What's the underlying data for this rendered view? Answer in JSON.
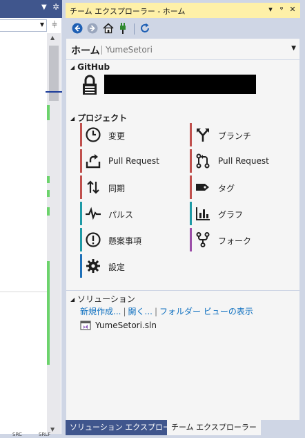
{
  "left_pane": {
    "status_left": "SRC",
    "status_right": "SRLF"
  },
  "window": {
    "title": "チーム エクスプローラー - ホーム",
    "dropdown_glyph": "▾",
    "pin_glyph": "📌",
    "close_glyph": "✕"
  },
  "toolbar": {
    "icons": [
      "back-icon",
      "forward-icon",
      "home-icon",
      "connect-icon",
      "refresh-icon"
    ]
  },
  "header": {
    "title": "ホーム",
    "repository": "YumeSetori"
  },
  "github": {
    "heading": "GitHub"
  },
  "project": {
    "heading": "プロジェクト",
    "tiles_left": [
      {
        "label": "変更",
        "icon": "clock-icon",
        "color": "#c0504d"
      },
      {
        "label": "Pull Request",
        "icon": "upload-icon",
        "color": "#c0504d"
      },
      {
        "label": "同期",
        "icon": "sync-icon",
        "color": "#c0504d"
      },
      {
        "label": "パルス",
        "icon": "pulse-icon",
        "color": "#1e9aa6"
      },
      {
        "label": "懸案事項",
        "icon": "issue-icon",
        "color": "#1e9aa6"
      },
      {
        "label": "設定",
        "icon": "gear-icon",
        "color": "#1e70b8"
      }
    ],
    "tiles_right": [
      {
        "label": "ブランチ",
        "icon": "branch-icon",
        "color": "#c0504d"
      },
      {
        "label": "Pull Request",
        "icon": "pull-request-icon",
        "color": "#c0504d"
      },
      {
        "label": "タグ",
        "icon": "tag-icon",
        "color": "#c0504d"
      },
      {
        "label": "グラフ",
        "icon": "graph-icon",
        "color": "#1e9aa6"
      },
      {
        "label": "フォーク",
        "icon": "fork-icon",
        "color": "#9b4ea8"
      }
    ]
  },
  "solutions": {
    "heading": "ソリューション",
    "new": "新規作成...",
    "open": "開く...",
    "folder_view": "フォルダー ビューの表示",
    "solution_file": "YumeSetori.sln"
  },
  "tabs": [
    {
      "label": "ソリューション エクスプローラー",
      "active": false
    },
    {
      "label": "チーム エクスプローラー",
      "active": true
    }
  ],
  "colors": {
    "title_bar": "#fef0a8",
    "toolbar": "#cfd6e5",
    "link": "#0e70c0",
    "accent_dark": "#40568d"
  }
}
